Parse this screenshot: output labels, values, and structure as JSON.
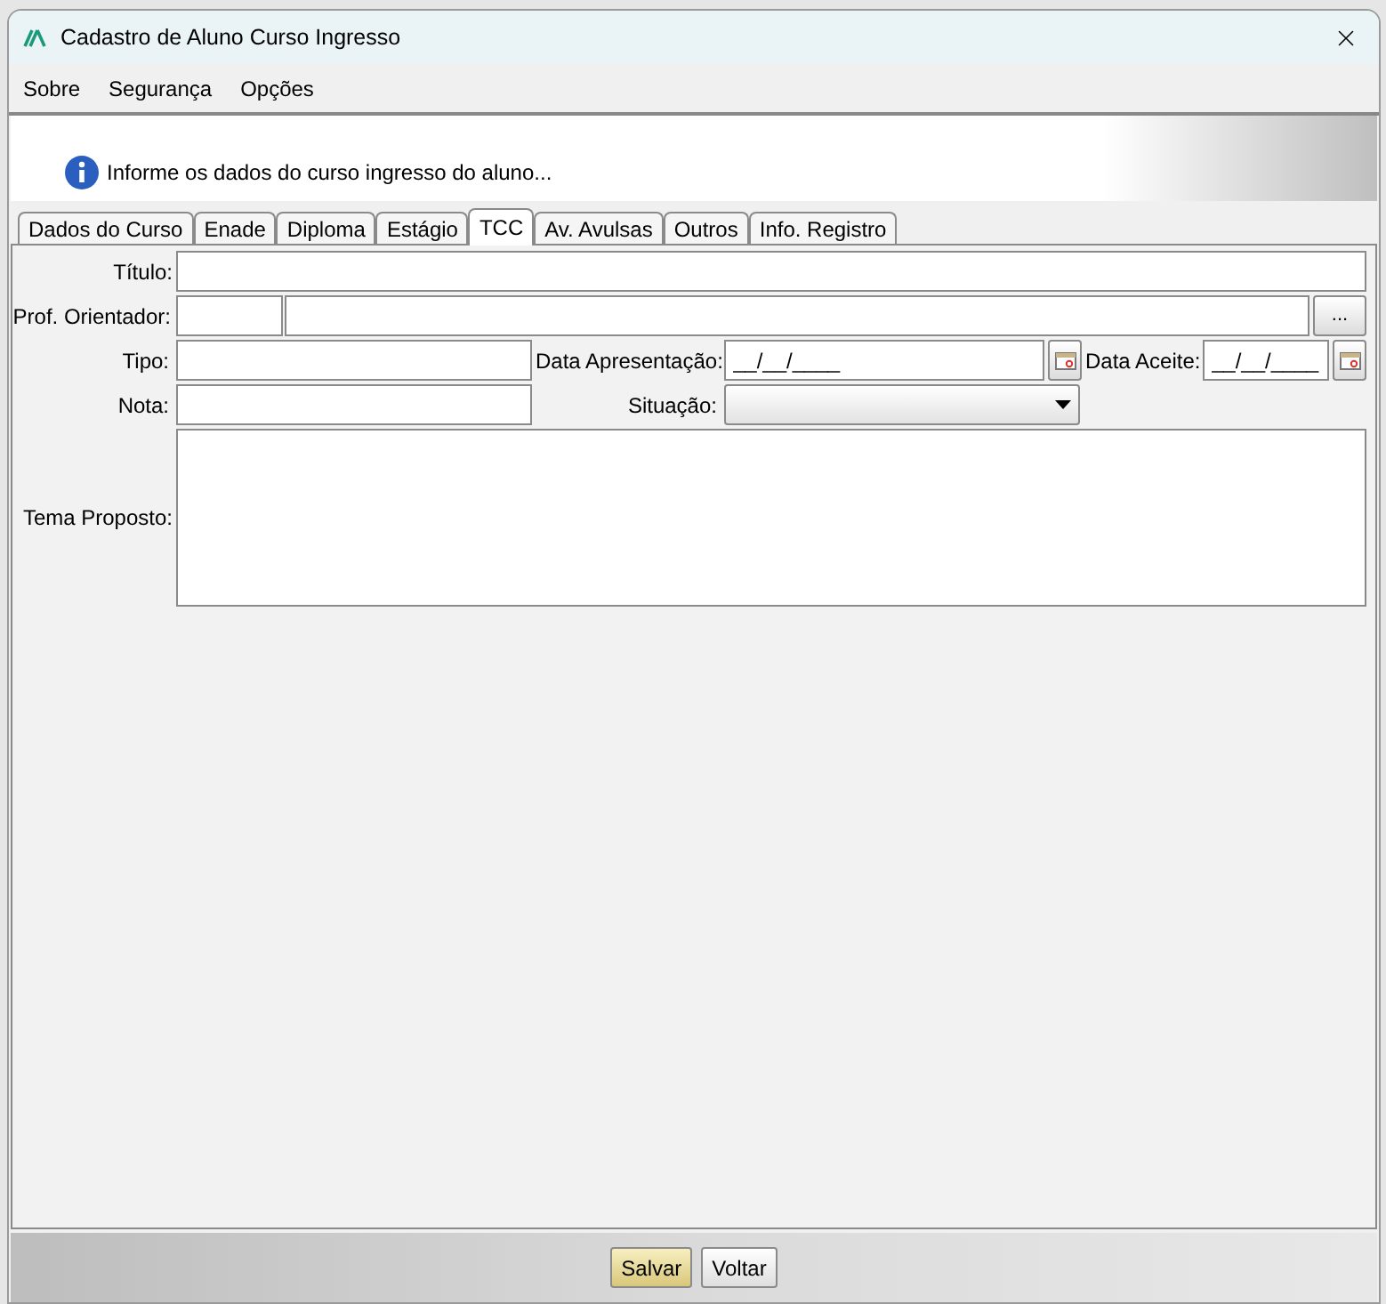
{
  "window": {
    "title": "Cadastro de Aluno Curso Ingresso"
  },
  "menu": [
    {
      "label": "Sobre"
    },
    {
      "label": "Segurança"
    },
    {
      "label": "Opções"
    }
  ],
  "banner": {
    "text": "Informe os dados do curso ingresso do aluno..."
  },
  "tabs": [
    {
      "label": "Dados do Curso",
      "selected": false
    },
    {
      "label": "Enade",
      "selected": false
    },
    {
      "label": "Diploma",
      "selected": false
    },
    {
      "label": "Estágio",
      "selected": false
    },
    {
      "label": "TCC",
      "selected": true
    },
    {
      "label": "Av. Avulsas",
      "selected": false
    },
    {
      "label": "Outros",
      "selected": false
    },
    {
      "label": "Info. Registro",
      "selected": false
    }
  ],
  "form": {
    "titulo": {
      "label": "Título:"
    },
    "orientador": {
      "label": "Prof. Orientador:",
      "button": "..."
    },
    "tipo": {
      "label": "Tipo:"
    },
    "data_apresentacao": {
      "label": "Data Apresentação:",
      "value": "__/__/____"
    },
    "data_aceite": {
      "label": "Data Aceite:",
      "value": "__/__/____"
    },
    "nota": {
      "label": "Nota:"
    },
    "situacao": {
      "label": "Situação:"
    },
    "tema": {
      "label": "Tema Proposto:"
    }
  },
  "buttons": [
    {
      "label": "Salvar",
      "kind": "primary"
    },
    {
      "label": "Voltar",
      "kind": "normal"
    }
  ]
}
